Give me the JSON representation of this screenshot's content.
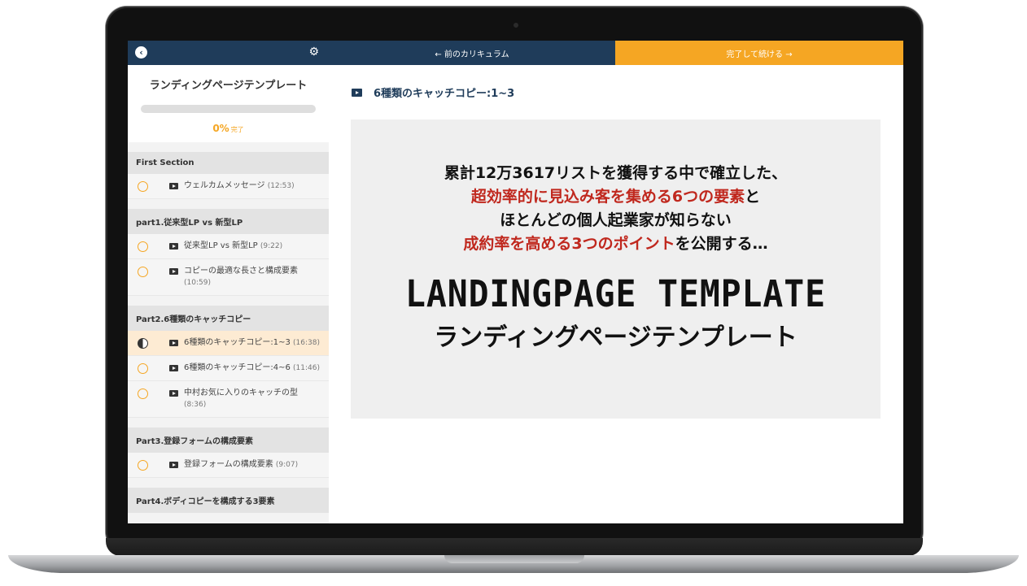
{
  "nav": {
    "back_icon": "chevron-left-icon",
    "settings_icon": "gear-icon",
    "prev_label": "← 前のカリキュラム",
    "next_label": "完了して続ける →"
  },
  "course": {
    "title": "ランディングページテンプレート",
    "progress_fraction": 0,
    "progress_value": "0%",
    "progress_suffix": "完了"
  },
  "sections": [
    {
      "title": "First Section",
      "lessons": [
        {
          "title": "ウェルカムメッセージ",
          "duration": "(12:53)",
          "status": "not-started"
        }
      ]
    },
    {
      "title": "part1.従来型LP vs 新型LP",
      "lessons": [
        {
          "title": "従来型LP vs 新型LP",
          "duration": "(9:22)",
          "status": "not-started"
        },
        {
          "title": "コピーの最適な長さと構成要素",
          "duration": "(10:59)",
          "status": "not-started"
        }
      ]
    },
    {
      "title": "Part2.6種類のキャッチコピー",
      "lessons": [
        {
          "title": "6種類のキャッチコピー:1~3",
          "duration": "(16:38)",
          "status": "in-progress"
        },
        {
          "title": "6種類のキャッチコピー:4~6",
          "duration": "(11:46)",
          "status": "not-started"
        },
        {
          "title": "中村お気に入りのキャッチの型",
          "duration": "(8:36)",
          "status": "not-started"
        }
      ]
    },
    {
      "title": "Part3.登録フォームの構成要素",
      "lessons": [
        {
          "title": "登録フォームの構成要素",
          "duration": "(9:07)",
          "status": "not-started"
        }
      ]
    },
    {
      "title": "Part4.ボディコピーを構成する3要素",
      "lessons": []
    }
  ],
  "main": {
    "lesson_title": "6種類のキャッチコピー:1~3",
    "hero": {
      "line1": "累計12万3617リストを獲得する中で確立した、",
      "line2_red": "超効率的に見込み客を集める6つの要素",
      "line2_suffix": "と",
      "line3": "ほとんどの個人起業家が知らない",
      "line4_red": "成約率を高める3つのポイント",
      "line4_suffix": "を公開する…",
      "title_en": "LANDINGPAGE TEMPLATE",
      "title_jp": "ランディングページテンプレート"
    }
  },
  "colors": {
    "navy": "#1f3c5a",
    "orange": "#f5a623",
    "red_text": "#c0281e"
  }
}
